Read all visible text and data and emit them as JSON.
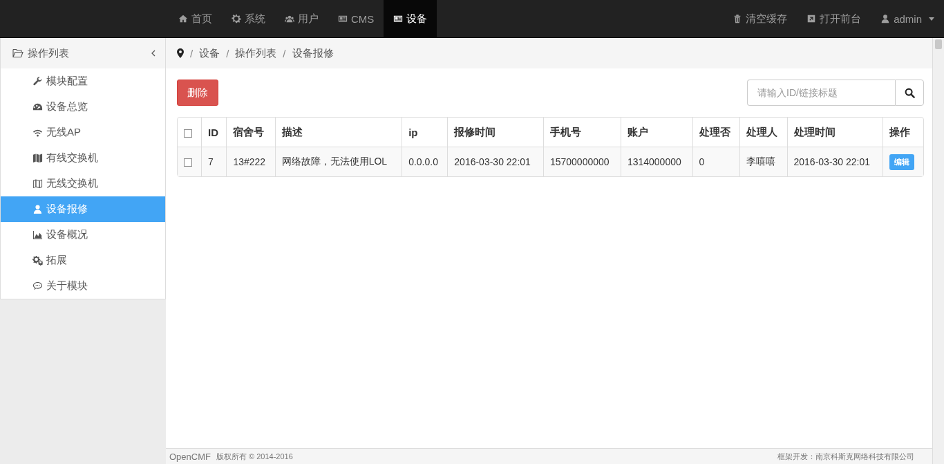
{
  "navbar": {
    "items": [
      {
        "label": "首页",
        "selected": false
      },
      {
        "label": "系统",
        "selected": false
      },
      {
        "label": "用户",
        "selected": false
      },
      {
        "label": "CMS",
        "selected": false
      },
      {
        "label": "设备",
        "selected": true
      }
    ],
    "right_items": [
      {
        "label": "清空缓存",
        "dropdown": false
      },
      {
        "label": "打开前台",
        "dropdown": false
      },
      {
        "label": "admin",
        "dropdown": true
      }
    ]
  },
  "sidebar": {
    "title": "操作列表",
    "items": [
      {
        "label": "模块配置",
        "selected": false
      },
      {
        "label": "设备总览",
        "selected": false
      },
      {
        "label": "无线AP",
        "selected": false
      },
      {
        "label": "有线交换机",
        "selected": false
      },
      {
        "label": "无线交换机",
        "selected": false
      },
      {
        "label": "设备报修",
        "selected": true
      },
      {
        "label": "设备概况",
        "selected": false
      },
      {
        "label": "拓展",
        "selected": false
      },
      {
        "label": "关于模块",
        "selected": false
      }
    ]
  },
  "breadcrumb": [
    {
      "separator": "/",
      "label": "设备"
    },
    {
      "separator": "/",
      "label": "操作列表"
    },
    {
      "separator": "/",
      "label": "设备报修"
    }
  ],
  "delete_button": "删除",
  "search": {
    "placeholder": "请输入ID/链接标题"
  },
  "table": {
    "header_checked": false,
    "columns": [
      "ID",
      "宿舍号",
      "描述",
      "ip",
      "报修时间",
      "手机号",
      "账户",
      "处理否",
      "处理人",
      "处理时间",
      "操作"
    ],
    "rows": [
      {
        "checked": false,
        "cells": [
          "7",
          "13#222",
          "网络故障，无法使用LOL",
          "0.0.0.0",
          "2016-03-30 22:01",
          "15700000000",
          "1314000000",
          "0",
          "李嘻嘻",
          "2016-03-30 22:01"
        ],
        "action": "编辑"
      }
    ]
  },
  "footer": {
    "brand": "OpenCMF",
    "copyright": "版权所有 © 2014-2016",
    "credit": "框架开发：南京科斯克网络科技有限公司"
  }
}
